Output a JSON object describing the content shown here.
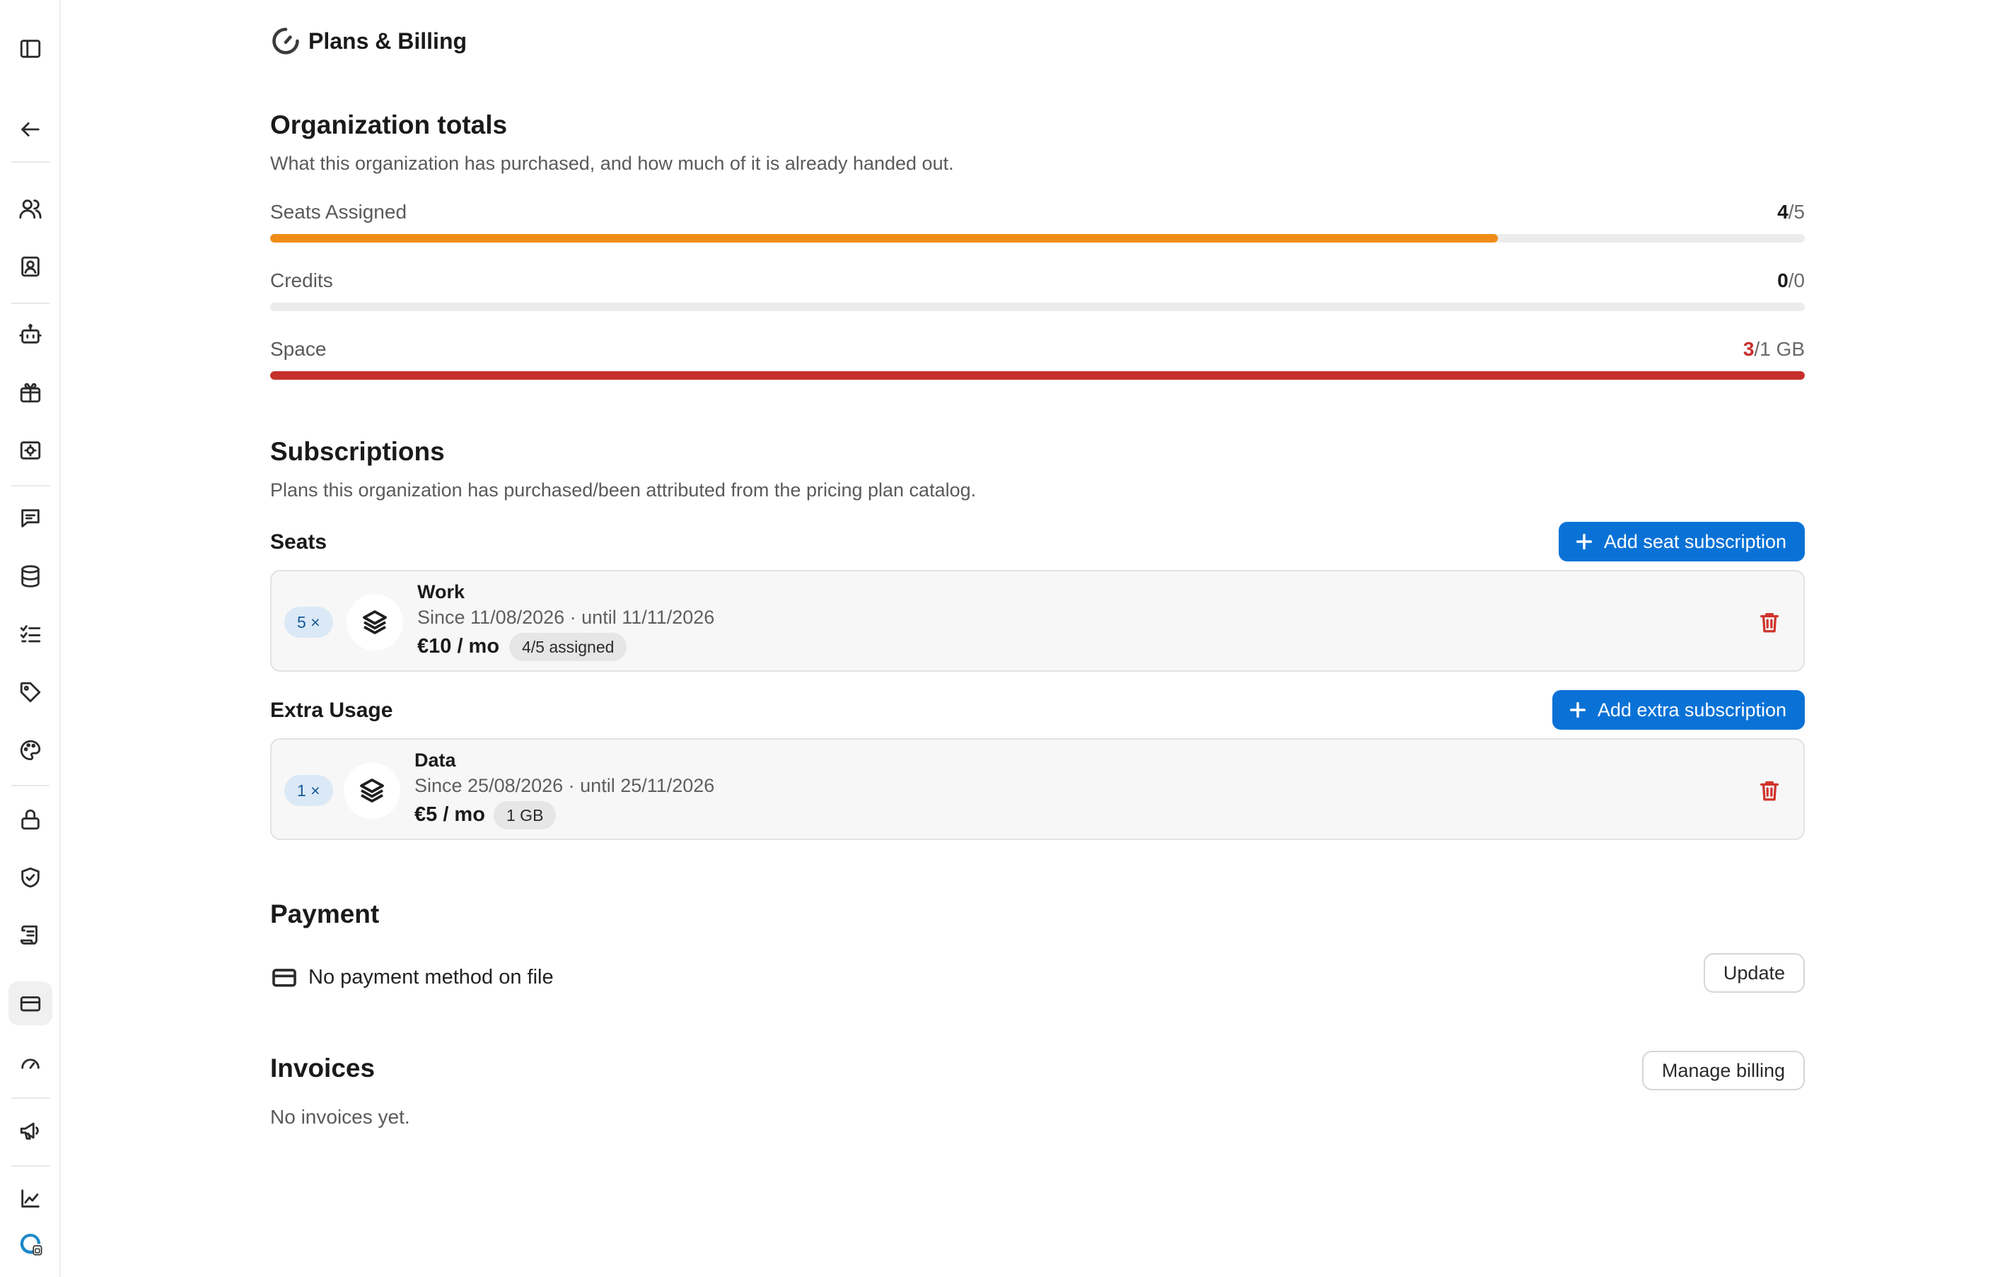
{
  "page": {
    "title": "Plans & Billing"
  },
  "sidebar": {
    "items": [
      {
        "name": "panel-toggle",
        "icon": "sidebar-panel-icon"
      },
      {
        "name": "back",
        "icon": "arrow-left-icon"
      },
      {
        "name": "members",
        "icon": "users-icon"
      },
      {
        "name": "contacts",
        "icon": "contact-book-icon"
      },
      {
        "name": "bots",
        "icon": "robot-icon"
      },
      {
        "name": "gifts",
        "icon": "gift-icon"
      },
      {
        "name": "screen-settings",
        "icon": "screen-gear-icon"
      },
      {
        "name": "messages",
        "icon": "chat-icon"
      },
      {
        "name": "database",
        "icon": "database-icon"
      },
      {
        "name": "tasks",
        "icon": "checklist-icon"
      },
      {
        "name": "tags",
        "icon": "tag-icon"
      },
      {
        "name": "appearance",
        "icon": "palette-icon"
      },
      {
        "name": "security",
        "icon": "lock-icon"
      },
      {
        "name": "compliance",
        "icon": "shield-check-icon"
      },
      {
        "name": "logs",
        "icon": "scroll-icon"
      },
      {
        "name": "billing",
        "icon": "credit-card-icon",
        "active": true
      },
      {
        "name": "usage",
        "icon": "gauge-icon"
      },
      {
        "name": "announcements",
        "icon": "megaphone-icon"
      },
      {
        "name": "analytics",
        "icon": "line-chart-icon"
      }
    ]
  },
  "org_totals": {
    "title": "Organization totals",
    "description": "What this organization has purchased, and how much of it is already handed out.",
    "meters": [
      {
        "label": "Seats Assigned",
        "used": "4",
        "total": "/5",
        "fraction": 0.8,
        "color": "#f08c16",
        "danger": false
      },
      {
        "label": "Credits",
        "used": "0",
        "total": "/0",
        "fraction": 0,
        "color": "#f08c16",
        "danger": false
      },
      {
        "label": "Space",
        "used": "3",
        "total": "/1 GB",
        "fraction": 1,
        "color": "#c6302b",
        "danger": true
      }
    ]
  },
  "subscriptions": {
    "title": "Subscriptions",
    "description": "Plans this organization has purchased/been attributed from the pricing plan catalog.",
    "seats": {
      "title": "Seats",
      "add_label": "Add seat subscription",
      "item": {
        "qty": "5 ×",
        "name": "Work",
        "dates": "Since 11/08/2026 · until 11/11/2026",
        "price": "€10 / mo",
        "chip": "4/5 assigned"
      }
    },
    "extra": {
      "title": "Extra Usage",
      "add_label": "Add extra subscription",
      "item": {
        "qty": "1 ×",
        "name": "Data",
        "dates": "Since 25/08/2026 · until 25/11/2026",
        "price": "€5 / mo",
        "chip": "1 GB"
      }
    }
  },
  "payment": {
    "title": "Payment",
    "method_text": "No payment method on file",
    "update_label": "Update"
  },
  "invoices": {
    "title": "Invoices",
    "manage_label": "Manage billing",
    "empty_text": "No invoices yet."
  }
}
